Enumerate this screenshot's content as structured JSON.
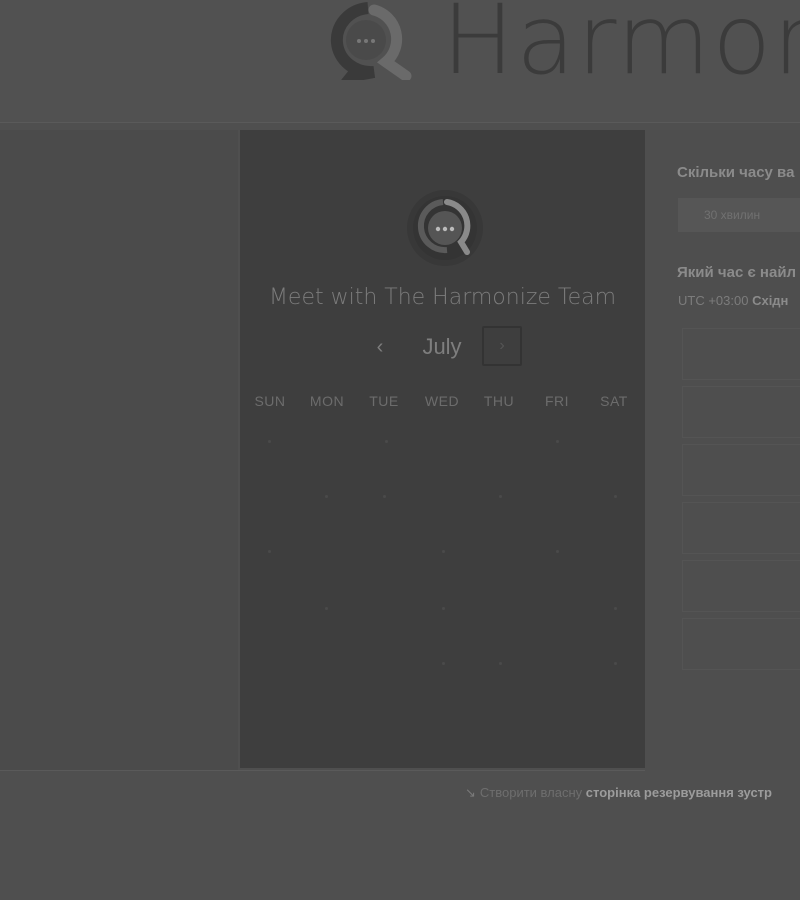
{
  "brand": {
    "name": "Harmon"
  },
  "calendar": {
    "title": "Meet with The Harmonize Team",
    "month": "July",
    "prev_icon": "‹",
    "next_icon": "›",
    "weekdays": [
      "SUN",
      "MON",
      "TUE",
      "WED",
      "THU",
      "FRI",
      "SAT"
    ]
  },
  "booking": {
    "duration_question": "Скільки часу ва",
    "duration_option": "30 хвилин",
    "time_question": "Який час є найл",
    "timezone_offset": "UTC +03:00",
    "timezone_name": "Східн"
  },
  "footer": {
    "prefix": "Створити власну",
    "link": "сторінка резервування зустр"
  },
  "colors": {
    "background": "#4f4f4f",
    "calendar_panel": "#3e3e3e"
  }
}
